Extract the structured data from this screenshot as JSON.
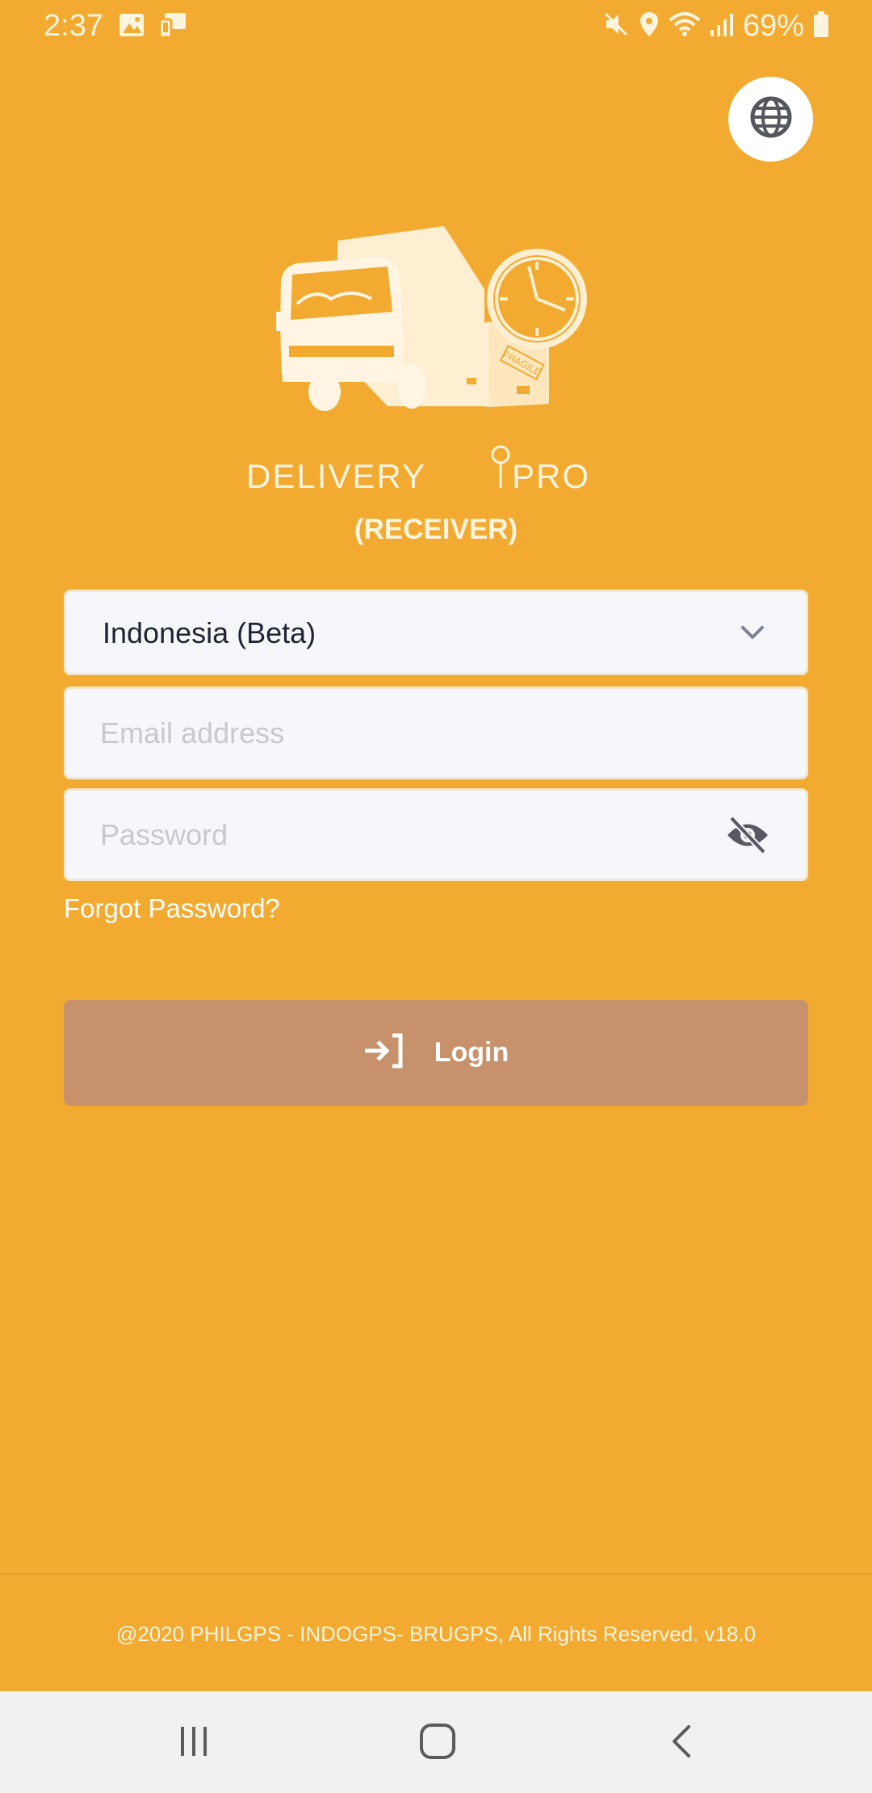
{
  "status_bar": {
    "time": "2:37",
    "battery": "69%",
    "left_icons": [
      "gallery-icon",
      "screen-mirror-icon"
    ],
    "right_icons": [
      "mute-icon",
      "location-icon",
      "wifi-icon",
      "signal-icon",
      "battery-icon"
    ]
  },
  "header": {
    "language_icon": "globe-icon"
  },
  "branding": {
    "logo_icon": "delivery-truck-clock-box-logo",
    "wordmark_left": "DELIVERY",
    "wordmark_right": "PRO",
    "box_label": "FRAGILE",
    "subtitle": "(RECEIVER)"
  },
  "form": {
    "country_value": "Indonesia (Beta)",
    "email_placeholder": "Email address",
    "email_value": "",
    "password_placeholder": "Password",
    "password_value": "",
    "forgot_password": "Forgot Password?"
  },
  "login_button": {
    "label": "Login",
    "icon": "login-arrow-icon"
  },
  "footer": {
    "copyright": "@2020 PHILGPS - INDOGPS- BRUGPS, All Rights Reserved. v18.0"
  },
  "nav_bar": {
    "icons": [
      "recents-icon",
      "home-icon",
      "back-icon"
    ]
  },
  "colors": {
    "background": "#F2AA31",
    "field_bg": "#F6F7FA",
    "login_button": "#C6916B",
    "text_light": "#FFF4DD",
    "nav_bar": "#F1F1F1"
  }
}
